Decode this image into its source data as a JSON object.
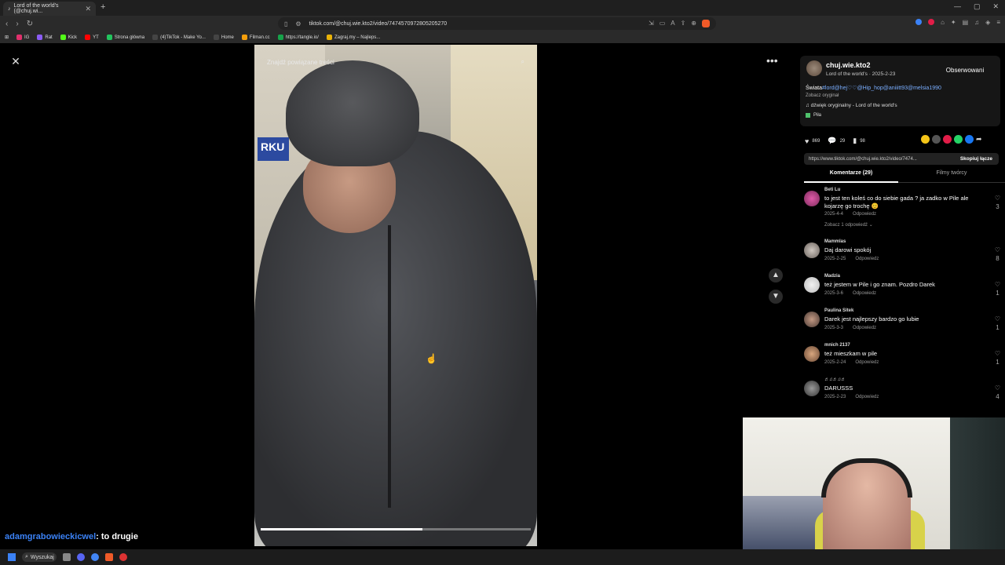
{
  "browser": {
    "tab_title": "Lord of the world's (@chuj.wi...",
    "url": "tiktok.com/@chuj.wie.kto2/video/7474570972805205270",
    "bookmarks": [
      "IG",
      "Rat",
      "Kick",
      "YT",
      "Strona główna",
      "(4)TikTok - Make Yo...",
      "Home",
      "Filman.cc",
      "https://tangle.io/",
      "Zagraj.my – Najleps..."
    ],
    "bookmark_colors": [
      "#e1306c",
      "#8b5cf6",
      "#53fc18",
      "#ff0000",
      "#22c55e",
      "#111111",
      "#111111",
      "#f59e0b",
      "#16a34a",
      "#eab308"
    ]
  },
  "video": {
    "search_placeholder": "Znajdź powiązane treści",
    "progress": 0.6
  },
  "author": {
    "username": "chuj.wie.kto2",
    "subtitle": "Lord of the world's · 2025-2-23",
    "follow_label": "Obserwowani",
    "desc_prefix": "Świata",
    "desc_tags": "#lord@hej♡♡@Hip_hop@aniiitt93@melsia1990",
    "see_original": "Zobacz oryginał",
    "sound": "♫ dźwięk oryginalny - Lord of the world's",
    "location": "Piła"
  },
  "stats": {
    "likes": "869",
    "comments": "29",
    "saves": "98"
  },
  "link": {
    "url": "https://www.tiktok.com/@chuj.wie.kto2/video/7474...",
    "copy_label": "Skopiuj łącze"
  },
  "tabs": {
    "comments": "Komentarze (29)",
    "creator_videos": "Filmy twórcy"
  },
  "comments": [
    {
      "user": "Beti Lu",
      "text": "to jest ten koleś co do siebie gada ? ja zadko w Pile ale kojarzę go trochę 😊",
      "date": "2025-4-4",
      "reply": "Odpowiedz",
      "likes": "3",
      "more": "Zobacz 1 odpowiedź ⌄"
    },
    {
      "user": "Mammlas",
      "text": "Daj darowi spokój",
      "date": "2025-2-25",
      "reply": "Odpowiedz",
      "likes": "8"
    },
    {
      "user": "Madzia",
      "text": "też jestem w Pile i go znam. Pozdro Darek",
      "date": "2025-3-6",
      "reply": "Odpowiedz",
      "likes": "1"
    },
    {
      "user": "Paulina Sitek",
      "text": "Darek jest najlepszy bardzo go lubie",
      "date": "2025-3-3",
      "reply": "Odpowiedz",
      "likes": "1"
    },
    {
      "user": "mnich 2137",
      "text": "też mieszkam w pile",
      "date": "2025-2-24",
      "reply": "Odpowiedz",
      "likes": "1"
    },
    {
      "user": "♬♫♬♫♬",
      "text": "DARUSSS",
      "date": "2025-2-23",
      "reply": "Odpowiedz",
      "likes": "4"
    }
  ],
  "chat": {
    "user": "adamgrabowieckicwel",
    "message": ": to drugie"
  },
  "taskbar": {
    "search": "Wyszukaj"
  }
}
